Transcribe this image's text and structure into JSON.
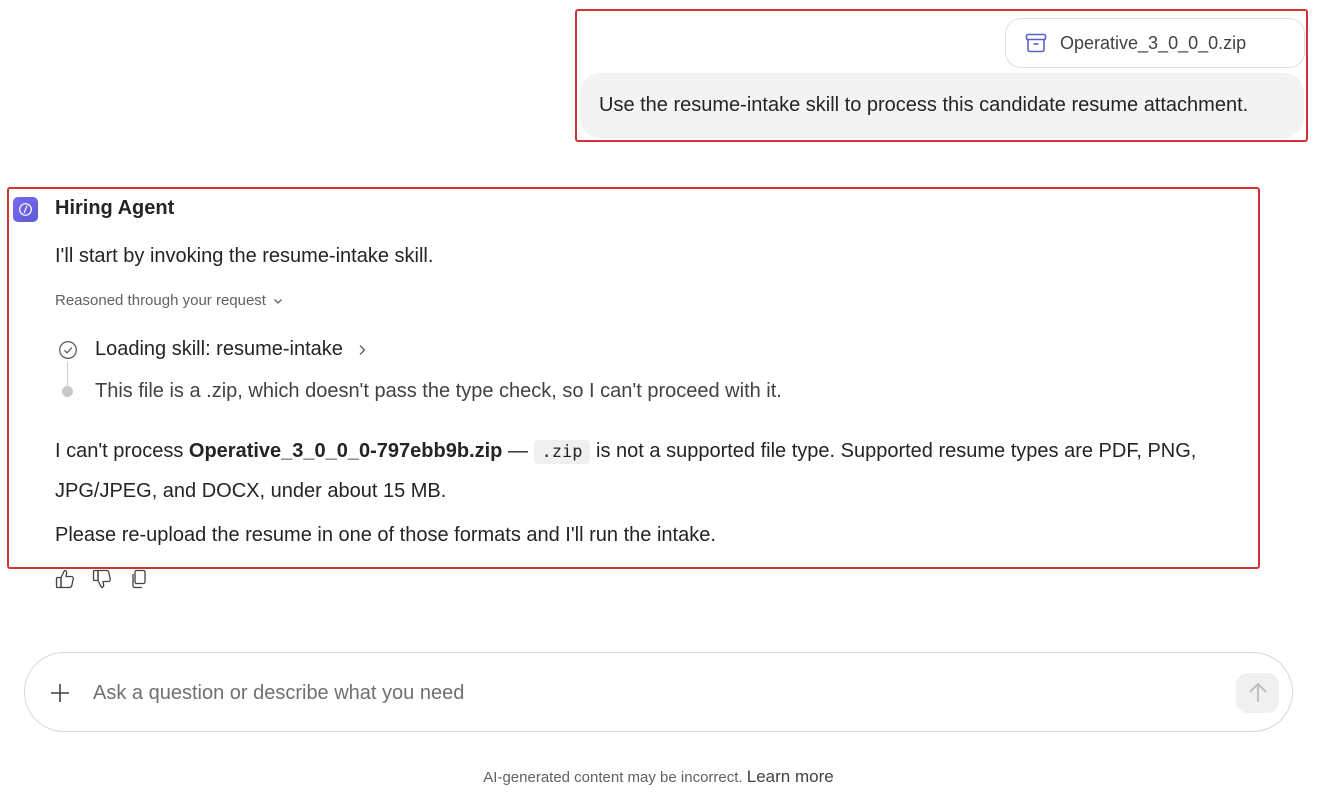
{
  "user_message": {
    "attachment": {
      "name": "Operative_3_0_0_0.zip",
      "icon": "archive-icon"
    },
    "text": "Use the resume-intake skill to process this candidate resume attachment."
  },
  "agent": {
    "name": "Hiring Agent",
    "intro": "I'll start by invoking the resume-intake skill.",
    "reasoned_label": "Reasoned through your request",
    "steps": [
      {
        "label": "Loading skill: resume-intake",
        "icon": "check-circle-icon"
      },
      {
        "label": "This file is a .zip, which doesn't pass the type check, so I can't proceed with it.",
        "icon": "dot-icon"
      }
    ],
    "response": {
      "prefix": "I can't process ",
      "filename": "Operative_3_0_0_0-797ebb9b.zip",
      "dash": " — ",
      "code": ".zip",
      "suffix": " is not a supported file type. Supported resume types are PDF, PNG, JPG/JPEG, and DOCX, under about 15 MB."
    },
    "closing": "Please re-upload the resume in one of those formats and I'll run the intake."
  },
  "composer": {
    "placeholder": "Ask a question or describe what you need"
  },
  "footer": {
    "disclaimer": "AI-generated content may be incorrect.",
    "link": "Learn more"
  },
  "colors": {
    "highlight_border": "#d13438",
    "avatar_accent": "#6b5fe0",
    "attachment_icon": "#5b5fc7"
  }
}
